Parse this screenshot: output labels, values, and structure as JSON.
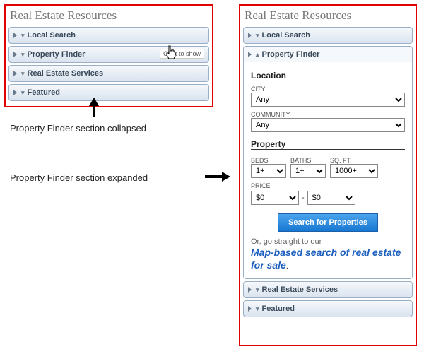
{
  "widget_title": "Real Estate Resources",
  "annotations": {
    "collapsed_caption": "Property Finder section collapsed",
    "expanded_caption": "Property Finder section expanded",
    "tooltip": "Click to show"
  },
  "sections": {
    "local_search": "Local Search",
    "property_finder": "Property Finder",
    "real_estate_services": "Real Estate Services",
    "featured": "Featured"
  },
  "finder": {
    "location_heading": "Location",
    "city_label": "CITY",
    "city_value": "Any",
    "community_label": "COMMUNITY",
    "community_value": "Any",
    "property_heading": "Property",
    "beds_label": "BEDS",
    "beds_value": "1+",
    "baths_label": "BATHS",
    "baths_value": "1+",
    "sqft_label": "SQ. FT.",
    "sqft_value": "1000+",
    "price_label": "PRICE",
    "price_min": "$0",
    "price_sep": "-",
    "price_max": "$0",
    "search_button": "Search for Properties",
    "or_text": "Or, go straight to our",
    "map_link": "Map-based search of real estate for sale",
    "period": "."
  }
}
